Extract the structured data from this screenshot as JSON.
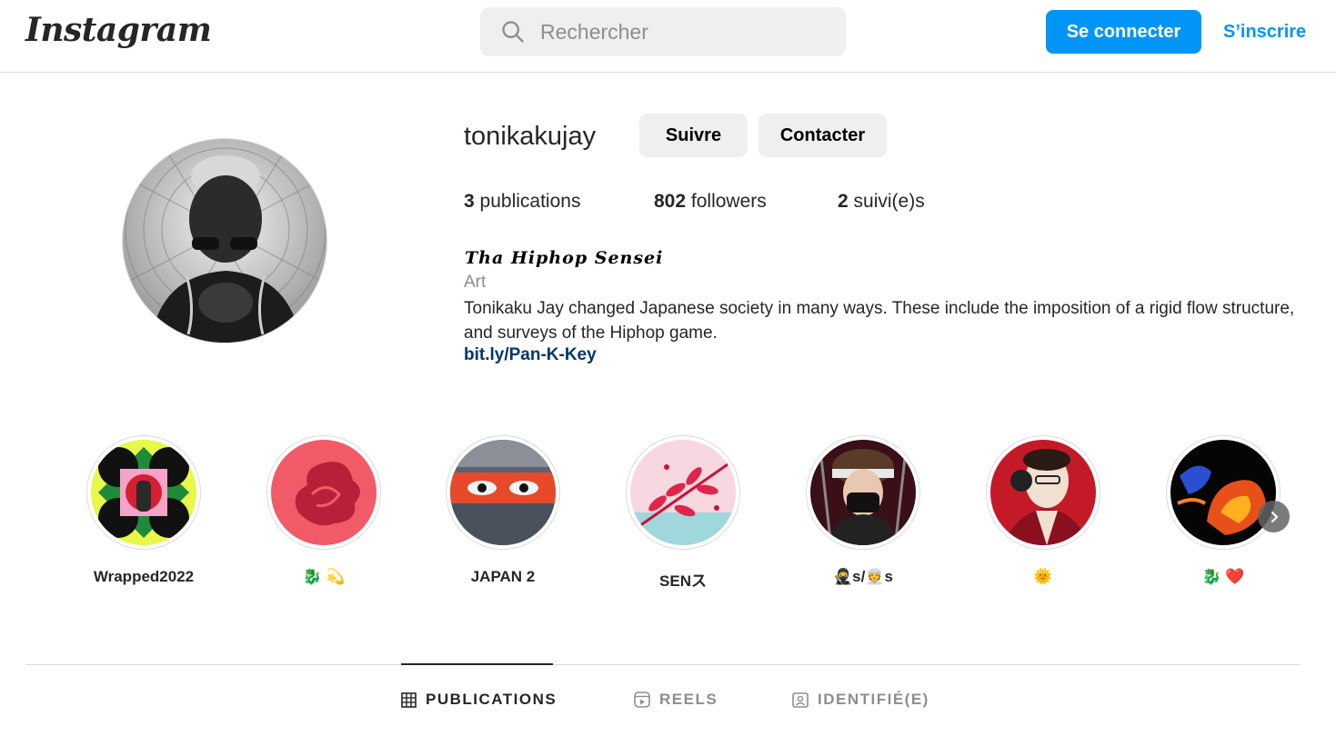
{
  "nav": {
    "logo_text": "Instagram",
    "search_placeholder": "Rechercher",
    "login_label": "Se connecter",
    "signup_label": "S’inscrire"
  },
  "profile": {
    "username": "tonikakujay",
    "follow_label": "Suivre",
    "contact_label": "Contacter",
    "stats": {
      "posts_count": "3",
      "posts_label": "publications",
      "followers_count": "802",
      "followers_label": "followers",
      "following_count": "2",
      "following_label": "suivi(e)s"
    },
    "full_name": "Tha Hiphop Sensei",
    "category": "Art",
    "bio": "Tonikaku Jay changed Japanese society in many ways. These include the imposition of a rigid flow structure, and surveys of the Hiphop game.",
    "link": "bit.ly/Pan-K-Key"
  },
  "highlights": [
    {
      "label": "Wrapped2022"
    },
    {
      "label": "🐉 💫"
    },
    {
      "label": "JAPAN 2"
    },
    {
      "label": "SENス"
    },
    {
      "label": "🥷s/👳s"
    },
    {
      "label": "🌞"
    },
    {
      "label": "🐉 ❤️"
    }
  ],
  "tabs": [
    {
      "label": "PUBLICATIONS",
      "active": true
    },
    {
      "label": "REELS",
      "active": false
    },
    {
      "label": "IDENTIFIÉ(E)",
      "active": false
    }
  ],
  "colors": {
    "accent": "#0095f6",
    "link": "#00376b",
    "muted": "#8e8e8e",
    "border": "#dbdbdb",
    "button_gray": "#efefef"
  }
}
